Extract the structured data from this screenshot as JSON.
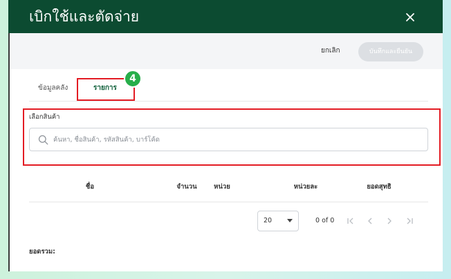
{
  "modal": {
    "title": "เบิกใช้และตัดจ่าย",
    "close_icon": "close-icon"
  },
  "actions": {
    "cancel_label": "ยกเลิก",
    "confirm_label": "บันทึกและยืนยัน"
  },
  "tabs": [
    {
      "label": "ข้อมูลคลัง",
      "active": false
    },
    {
      "label": "รายการ",
      "active": true
    }
  ],
  "annotation": {
    "step": "4"
  },
  "product_picker": {
    "label": "เลือกสินค้า",
    "placeholder": "ค้นหา, ชื่อสินค้า, รหัสสินค้า, บาร์โค้ด",
    "value": "",
    "icon": "search-icon"
  },
  "table": {
    "columns": [
      "ชื่อ",
      "จำนวน",
      "หน่วย",
      "หน่วยละ",
      "ยอดสุทธิ"
    ],
    "rows": []
  },
  "pagination": {
    "page_size": "20",
    "range": "0 of 0",
    "icons": [
      "first-page-icon",
      "prev-page-icon",
      "next-page-icon",
      "last-page-icon"
    ]
  },
  "summary": {
    "total_label": "ยอดรวม:"
  },
  "colors": {
    "header_bg": "#0c4b31",
    "accent": "#0b5c36",
    "annotation": "#e31b23",
    "badge": "#27ae4a"
  }
}
